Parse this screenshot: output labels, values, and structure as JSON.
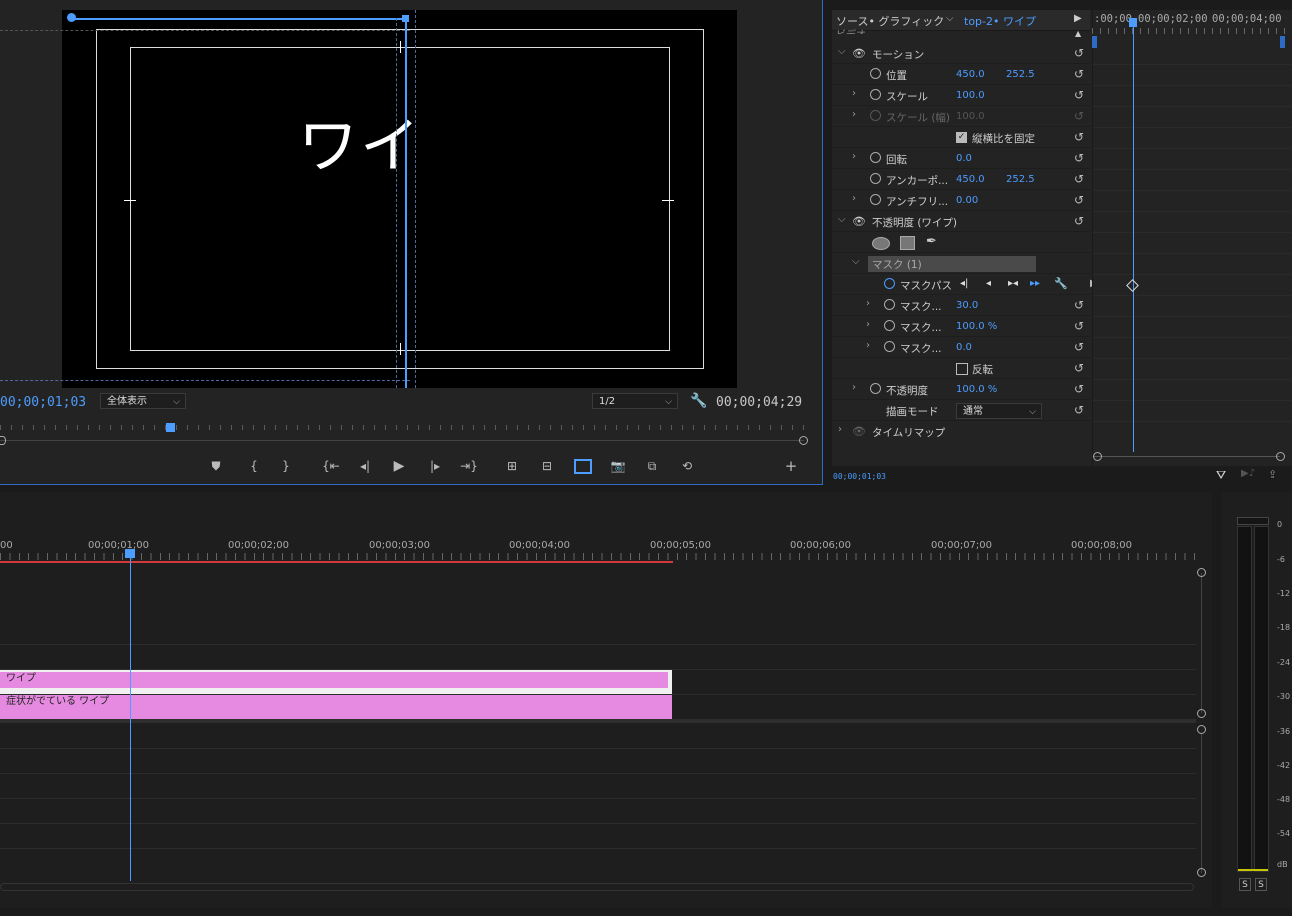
{
  "program_monitor": {
    "preview_text": "ワイ",
    "current_timecode": "00;00;01;03",
    "fit_dropdown": "全体表示",
    "resolution_dropdown": "1/2",
    "duration_timecode": "00;00;04;29"
  },
  "effect_controls": {
    "source_tab": "ソース• グラフィック",
    "sequence_tab": "top-2• ワイプ",
    "header_partial": "ビデオ",
    "keyframe_timecodes": [
      ":00;00",
      "00;00;02;00",
      "00;00;04;00"
    ],
    "footer_timecode": "00;00;01;03",
    "rows": {
      "motion": "モーション",
      "position_label": "位置",
      "position_x": "450.0",
      "position_y": "252.5",
      "scale_label": "スケール",
      "scale_value": "100.0",
      "scale_width_label": "スケール (幅)",
      "scale_width_value": "100.0",
      "uniform_scale_label": "縦横比を固定",
      "rotation_label": "回転",
      "rotation_value": "0.0",
      "anchor_label": "アンカーポ...",
      "anchor_x": "450.0",
      "anchor_y": "252.5",
      "antiflicker_label": "アンチフリ...",
      "antiflicker_value": "0.00",
      "opacity_group": "不透明度 (ワイプ)",
      "mask_name": "マスク (1)",
      "mask_path_label": "マスクパス",
      "mask_feather_label": "マスク...",
      "mask_feather_value": "30.0",
      "mask_opacity_label": "マスク...",
      "mask_opacity_value": "100.0 %",
      "mask_expansion_label": "マスク...",
      "mask_expansion_value": "0.0",
      "invert_label": "反転",
      "opacity_label": "不透明度",
      "opacity_value": "100.0 %",
      "blend_mode_label": "描画モード",
      "blend_mode_value": "通常",
      "time_remap": "タイムリマップ"
    }
  },
  "timeline": {
    "ruler_labels": [
      "00",
      "00;00;01;00",
      "00;00;02;00",
      "00;00;03;00",
      "00;00;04;00",
      "00;00;05;00",
      "00;00;06;00",
      "00;00;07;00",
      "00;00;08;00"
    ],
    "clips": [
      {
        "name": "ワイプ"
      },
      {
        "name": "症状がでている ワイプ"
      }
    ]
  },
  "audio_meter": {
    "db_labels": [
      "0",
      "-6",
      "-12",
      "-18",
      "-24",
      "-30",
      "-36",
      "-42",
      "-48",
      "-54",
      "dB"
    ],
    "solo_buttons": [
      "S",
      "S"
    ]
  },
  "colors": {
    "accent_blue": "#4d9cff",
    "clip_pink": "#e58ae0",
    "work_area_red": "#d23a3a"
  }
}
